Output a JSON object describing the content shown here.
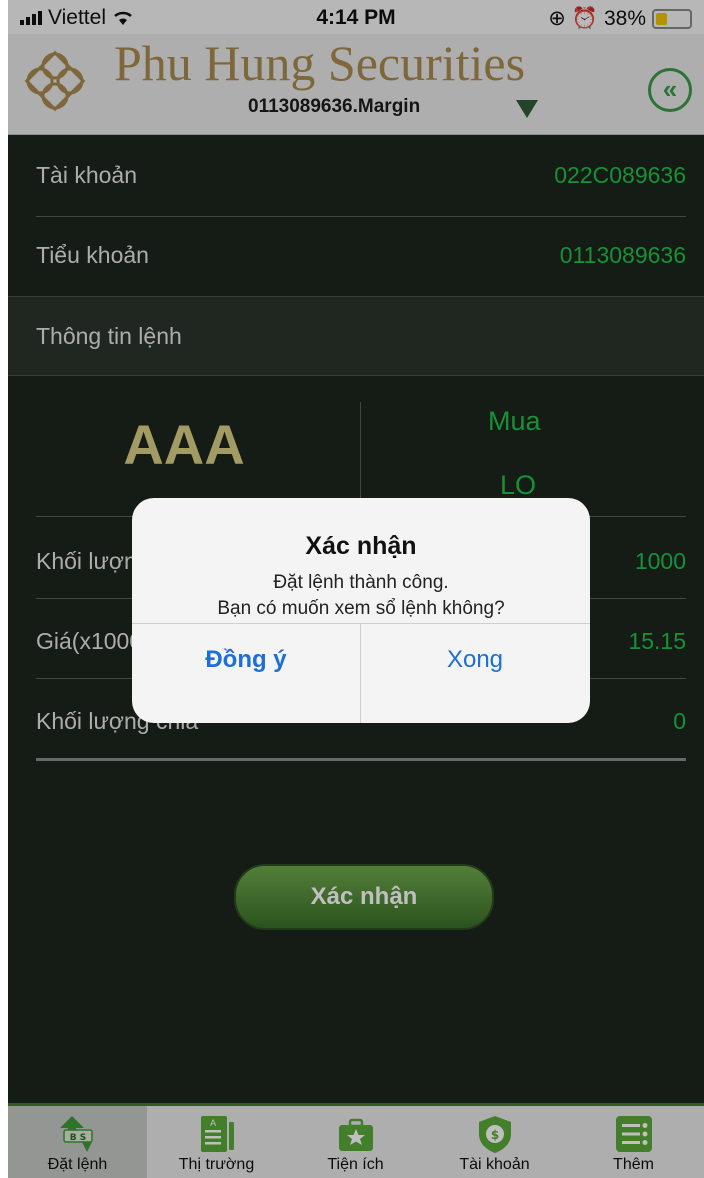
{
  "status_bar": {
    "carrier": "Viettel",
    "time": "4:14 PM",
    "battery": "38%"
  },
  "header": {
    "brand": "Phu Hung Securities",
    "account_selector": "0113089636.Margin",
    "back_icon": "double-chevron-left-icon"
  },
  "account": {
    "rows": [
      {
        "label": "Tài khoản",
        "value": "022C089636"
      },
      {
        "label": "Tiểu khoản",
        "value": "0113089636"
      }
    ]
  },
  "order_section_title": "Thông tin lệnh",
  "order": {
    "symbol": "AAA",
    "side": "Mua",
    "order_type": "LO",
    "rows": [
      {
        "label": "Khối lượng",
        "value": "1000"
      },
      {
        "label": "Giá(x1000)",
        "value": "15.15"
      },
      {
        "label": "Khối lượng chia",
        "value": "0"
      }
    ]
  },
  "confirm_button": "Xác nhận",
  "dialog": {
    "title": "Xác nhận",
    "message_line1": "Đặt lệnh thành công.",
    "message_line2": "Bạn có muốn xem sổ lệnh không?",
    "ok": "Đồng ý",
    "cancel": "Xong"
  },
  "tabs": [
    {
      "label": "Đặt lệnh",
      "icon": "buy-sell-icon",
      "active": true
    },
    {
      "label": "Thị trường",
      "icon": "market-board-icon",
      "active": false
    },
    {
      "label": "Tiện ích",
      "icon": "utilities-briefcase-icon",
      "active": false
    },
    {
      "label": "Tài khoản",
      "icon": "account-shield-icon",
      "active": false
    },
    {
      "label": "Thêm",
      "icon": "more-menu-icon",
      "active": false
    }
  ],
  "colors": {
    "background": "#1c241c",
    "value_green": "#1fc24a",
    "symbol_gold": "#d8cf86",
    "brand_gold": "#a88a4e",
    "link_blue": "#1c6fd6"
  }
}
